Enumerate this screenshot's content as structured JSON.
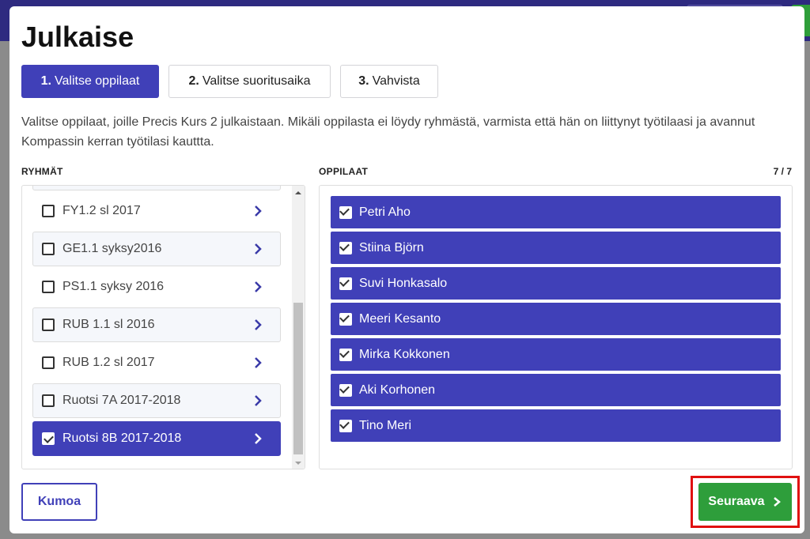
{
  "dialog": {
    "title": "Julkaise",
    "steps": [
      {
        "number": "1.",
        "label": "Valitse oppilaat",
        "active": true
      },
      {
        "number": "2.",
        "label": "Valitse suoritusaika",
        "active": false
      },
      {
        "number": "3.",
        "label": "Vahvista",
        "active": false
      }
    ],
    "description": "Valitse oppilaat, joille Precis Kurs 2 julkaistaan. Mikäli oppilasta ei löydy ryhmästä, varmista että hän on liittynyt työtilaasi ja avannut Kompassin kerran työtilasi kauttta."
  },
  "groups": {
    "heading": "RYHMÄT",
    "items": [
      {
        "label": "FY1.2 sl 2017",
        "checked": false
      },
      {
        "label": "GE1.1 syksy2016",
        "checked": false
      },
      {
        "label": "PS1.1 syksy 2016",
        "checked": false
      },
      {
        "label": "RUB 1.1 sl 2016",
        "checked": false
      },
      {
        "label": "RUB 1.2 sl 2017",
        "checked": false
      },
      {
        "label": "Ruotsi 7A 2017-2018",
        "checked": false
      },
      {
        "label": "Ruotsi 8B 2017-2018",
        "checked": true
      }
    ]
  },
  "students": {
    "heading": "OPPILAAT",
    "count": "7 / 7",
    "items": [
      {
        "name": "Petri Aho",
        "checked": true
      },
      {
        "name": "Stiina Björn",
        "checked": true
      },
      {
        "name": "Suvi Honkasalo",
        "checked": true
      },
      {
        "name": "Meeri Kesanto",
        "checked": true
      },
      {
        "name": "Mirka Kokkonen",
        "checked": true
      },
      {
        "name": "Aki Korhonen",
        "checked": true
      },
      {
        "name": "Tino Meri",
        "checked": true
      }
    ]
  },
  "footer": {
    "cancel_label": "Kumoa",
    "next_label": "Seuraava"
  },
  "colors": {
    "accent": "#4040b8",
    "success": "#2e9e3b",
    "highlight": "#e01010"
  },
  "icons": {
    "chevron": "chevron-right-icon",
    "checkbox": "checkbox-icon"
  }
}
